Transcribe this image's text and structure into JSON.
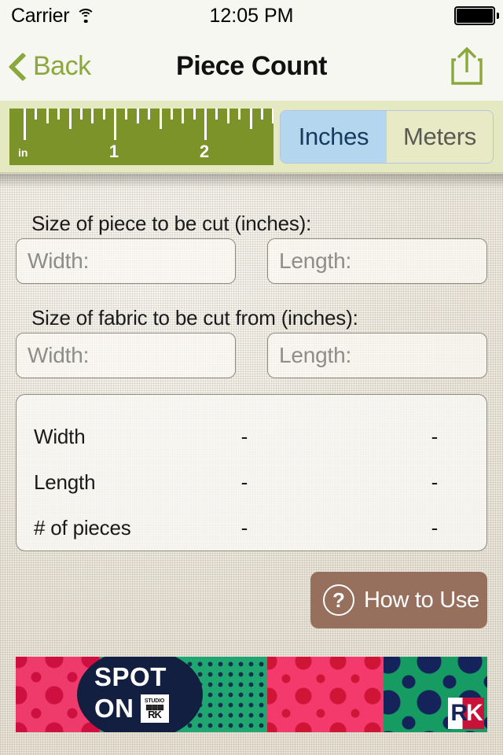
{
  "status_bar": {
    "carrier": "Carrier",
    "wifi_icon": "wifi-icon",
    "time": "12:05 PM",
    "battery_icon": "battery-full-icon"
  },
  "nav_bar": {
    "back_label": "Back",
    "back_chevron_icon": "chevron-left-icon",
    "title": "Piece Count",
    "share_icon": "share-icon",
    "accent_color": "#8aa83c",
    "background_color": "#f7f7f2"
  },
  "unit_bar": {
    "background_color": "#e5e9c1",
    "ruler": {
      "unit_abbr": "in",
      "color": "#7b9329",
      "numbers": [
        "1",
        "2"
      ]
    },
    "segmented_control": {
      "options": [
        "Inches",
        "Meters"
      ],
      "selected": "Inches",
      "active_bg": "#b4d7ef",
      "active_text": "#173a5e",
      "inactive_bg": "#e7eac4",
      "inactive_text": "#5a5a52"
    }
  },
  "form": {
    "piece_section_label": "Size of piece to be cut (inches):",
    "piece_width_placeholder": "Width:",
    "piece_width_value": "",
    "piece_length_placeholder": "Length:",
    "piece_length_value": "",
    "fabric_section_label": "Size of fabric to be cut from (inches):",
    "fabric_width_placeholder": "Width:",
    "fabric_width_value": "",
    "fabric_length_placeholder": "Length:",
    "fabric_length_value": ""
  },
  "results": {
    "rows": [
      {
        "label": "Width",
        "value1": "-",
        "value2": "-"
      },
      {
        "label": "Length",
        "value1": "-",
        "value2": "-"
      },
      {
        "label": "# of pieces",
        "value1": "-",
        "value2": "-"
      }
    ]
  },
  "help_button": {
    "label": "How to Use",
    "icon": "question-mark-circle-icon",
    "background_color": "#96705c"
  },
  "ad_banner": {
    "brand_line1": "SPOT",
    "brand_line2": "ON",
    "studio_top": "STUDIO",
    "studio_mid": "▩▩▩",
    "studio_bottom": "RK",
    "corner_logo_r": "R",
    "corner_logo_k": "K",
    "colors": {
      "pink": "#ef3b6b",
      "green": "#1fa671",
      "navy": "#131f40",
      "dark_red": "#cd1040"
    }
  }
}
